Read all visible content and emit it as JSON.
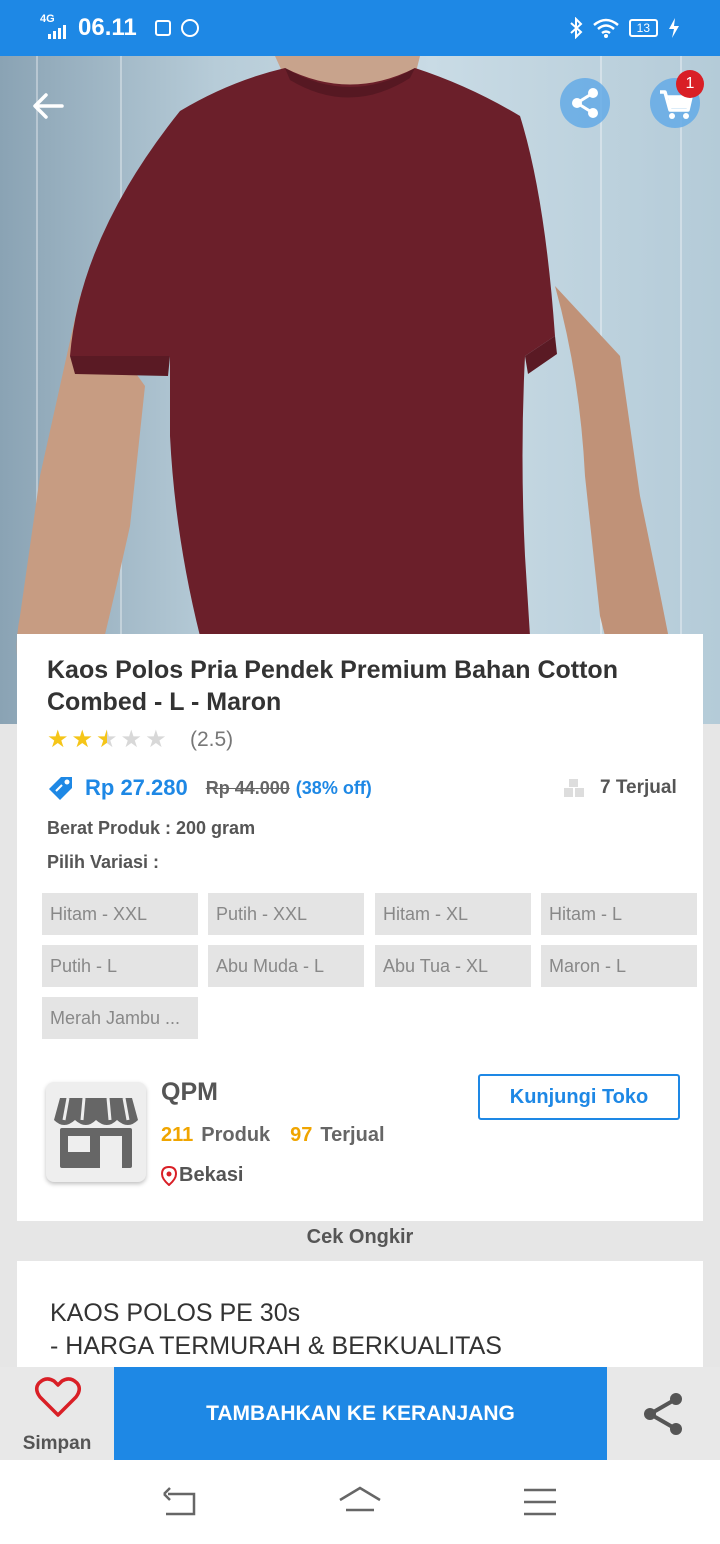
{
  "status_bar": {
    "network": "4G",
    "time": "06.11",
    "battery": "13"
  },
  "header": {
    "cart_badge": "1"
  },
  "product": {
    "title": "Kaos Polos Pria Pendek Premium Bahan Cotton Combed - L - Maron",
    "rating": 2.5,
    "rating_text": "(2.5)",
    "price": "Rp 27.280",
    "original_price": "Rp 44.000",
    "discount": "(38% off)",
    "sold": "7 Terjual",
    "weight": "Berat Produk : 200 gram",
    "variant_label": "Pilih Variasi :",
    "variants": [
      "Hitam - XXL",
      "Putih - XXL",
      "Hitam - XL",
      "Hitam - L",
      "Putih - L",
      "Abu Muda - L",
      "Abu Tua - XL",
      "Maron - L",
      "Merah Jambu ..."
    ]
  },
  "store": {
    "name": "QPM",
    "product_count": "211",
    "product_label": "Produk",
    "sold_count": "97",
    "sold_label": "Terjual",
    "location": "Bekasi",
    "visit_label": "Kunjungi Toko"
  },
  "shipping": {
    "label": "Cek Ongkir"
  },
  "description": {
    "lines": [
      "KAOS POLOS PE 30s",
      "- HARGA TERMURAH & BERKUALITAS"
    ]
  },
  "action_bar": {
    "save_label": "Simpan",
    "add_to_cart_label": "TAMBAHKAN KE KERANJANG"
  },
  "colors": {
    "primary": "#1e88e5",
    "star": "#f5c518",
    "badge": "#d91f26",
    "shirt": "#6b1f2a",
    "accent_number": "#f0a500"
  },
  "icons": [
    "back-arrow-icon",
    "share-icon",
    "cart-icon",
    "star-icon",
    "price-tag-icon",
    "box-icon",
    "store-icon",
    "location-pin-icon",
    "heart-icon",
    "nav-back-icon",
    "nav-home-icon",
    "nav-menu-icon"
  ]
}
